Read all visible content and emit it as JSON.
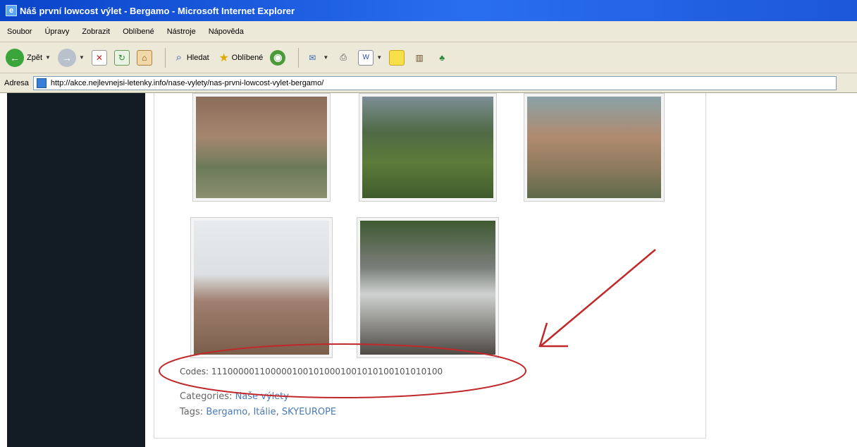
{
  "window": {
    "title": "Náš první lowcost výlet - Bergamo - Microsoft Internet Explorer"
  },
  "menu": {
    "items": [
      "Soubor",
      "Úpravy",
      "Zobrazit",
      "Oblíbené",
      "Nástroje",
      "Nápověda"
    ]
  },
  "toolbar": {
    "back_label": "Zpět",
    "search_label": "Hledat",
    "favorites_label": "Oblíbené"
  },
  "address": {
    "label": "Adresa",
    "url": "http://akce.nejlevnejsi-letenky.info/nase-vylety/nas-prvni-lowcost-vylet-bergamo/"
  },
  "post": {
    "codes_text": "Codes: 1110000011000001001010001001010100101010100",
    "categories_label": "Categories:",
    "categories_value": "Naše výlety",
    "tags_label": "Tags:",
    "tags": [
      "Bergamo",
      "Itálie",
      "SKYEUROPE"
    ]
  },
  "colors": {
    "titlebar": "#0a44c8",
    "chrome": "#ece9d8",
    "sidebar": "#131b24",
    "annotation": "#c0282a",
    "link": "#4a7ab8"
  }
}
